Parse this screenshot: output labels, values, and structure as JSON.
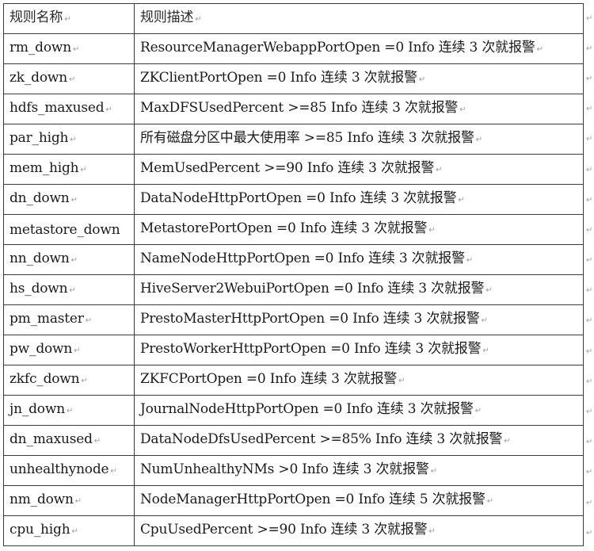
{
  "table": {
    "headers": [
      "规则名称",
      "规则描述"
    ],
    "paragraph_mark": "↵",
    "rows": [
      {
        "name": "rm_down",
        "description": "ResourceManagerWebappPortOpen =0 Info 连续 3 次就报警"
      },
      {
        "name": "zk_down",
        "description": "ZKClientPortOpen =0 Info 连续 3 次就报警"
      },
      {
        "name": "hdfs_maxused",
        "description": "MaxDFSUsedPercent >=85 Info 连续 3 次就报警"
      },
      {
        "name": "par_high",
        "description": "所有磁盘分区中最大使用率 >=85 Info 连续 3 次就报警"
      },
      {
        "name": "mem_high",
        "description": "MemUsedPercent >=90 Info 连续 3 次就报警"
      },
      {
        "name": "dn_down",
        "description": "DataNodeHttpPortOpen =0 Info 连续 3 次就报警"
      },
      {
        "name": "metastore_down",
        "description": "MetastorePortOpen =0 Info 连续 3 次就报警"
      },
      {
        "name": "nn_down",
        "description": "NameNodeHttpPortOpen =0 Info 连续 3 次就报警"
      },
      {
        "name": "hs_down",
        "description": "HiveServer2WebuiPortOpen =0 Info 连续 3 次就报警"
      },
      {
        "name": "pm_master",
        "description": "PrestoMasterHttpPortOpen =0 Info 连续 3 次就报警"
      },
      {
        "name": "pw_down",
        "description": "PrestoWorkerHttpPortOpen =0 Info 连续 3 次就报警"
      },
      {
        "name": "zkfc_down",
        "description": "ZKFCPortOpen =0 Info 连续 3 次就报警"
      },
      {
        "name": "jn_down",
        "description": "JournalNodeHttpPortOpen =0 Info 连续 3 次就报警"
      },
      {
        "name": "dn_maxused",
        "description": "DataNodeDfsUsedPercent >=85% Info 连续 3 次就报警"
      },
      {
        "name": "unhealthynode",
        "description": "NumUnhealthyNMs >0 Info 连续 3 次就报警"
      },
      {
        "name": "nm_down",
        "description": "NodeManagerHttpPortOpen =0 Info 连续 5 次就报警"
      },
      {
        "name": "cpu_high",
        "description": "CpuUsedPercent >=90 Info 连续 3 次就报警"
      }
    ]
  }
}
